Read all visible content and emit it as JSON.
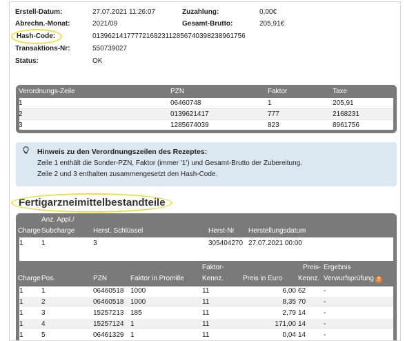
{
  "details": {
    "erstell_label": "Erstell-Datum:",
    "erstell_value": "27.07.2021 11:26:07",
    "zuzahlung_label": "Zuzahlung:",
    "zuzahlung_value": "0,00€",
    "abrechn_label": "Abrechn.-Monat:",
    "abrechn_value": "2021/09",
    "brutto_label": "Gesamt-Brutto:",
    "brutto_value": "205,91€",
    "hash_label": "Hash-Code:",
    "hash_value": "01396214177772168231128567403982389617 56",
    "hash_value_exact": "013962141777721682311285674039823896175 6",
    "trans_label": "Transaktions-Nr:",
    "trans_value": "550739027",
    "status_label": "Status:",
    "status_value": "OK"
  },
  "verordnung": {
    "headers": [
      "Verordnungs-Zeile",
      "PZN",
      "Faktor",
      "Taxe"
    ],
    "rows": [
      [
        "1",
        "06460748",
        "1",
        "205,91"
      ],
      [
        "2",
        "0139621417",
        "777",
        "2168231"
      ],
      [
        "3",
        "1285674039",
        "823",
        "8961756"
      ]
    ]
  },
  "hinweis": {
    "icon": "lightbulb-icon",
    "title": "Hinweis zu den Verordnungszeilen des Rezeptes:",
    "line1": "Zeile 1 enthält die Sonder-PZN, Faktor (immer '1') und Gesamt-Brutto der Zubereitung.",
    "line2": "Zeile 2 und 3 enthalten zusammengesetzt den Hash-Code."
  },
  "fertig": {
    "title": "Fertigarzneimittelbestandteile",
    "charge_table": {
      "h_anz1": "Anz. Appl./",
      "h_charge": "Charge",
      "h_subcharge": "Subcharge",
      "h_herst": "Herst. Schlüssel",
      "h_herstnr": "Herst-Nr",
      "h_datum": "Herstellungsdatum",
      "row": [
        "1",
        "1",
        "3",
        "305404270",
        "27.07.2021 00:00"
      ]
    },
    "pos_table": {
      "h_charge": "Charge",
      "h_pos": "Pos.",
      "h_pzn": "PZN",
      "h_faktor": "Faktor in Promille",
      "h_kennz1": "Faktor-",
      "h_kennz2": "Kennz.",
      "h_preis": "Preis in Euro",
      "h_pk1": "Preis-",
      "h_pk2": "Kennz.",
      "h_erg1": "Ergebnis",
      "h_erg2": "Verwurfsprüfung",
      "help_icon": "question-icon",
      "rows": [
        [
          "1",
          "1",
          "06460518",
          "1000",
          "11",
          "6,00",
          "62",
          "-"
        ],
        [
          "1",
          "2",
          "06460518",
          "1000",
          "11",
          "8,35",
          "70",
          "-"
        ],
        [
          "1",
          "3",
          "15257213",
          "185",
          "11",
          "2,79",
          "14",
          "-"
        ],
        [
          "1",
          "4",
          "15257124",
          "1",
          "11",
          "171,00",
          "14",
          "-"
        ],
        [
          "1",
          "5",
          "06461329",
          "1",
          "11",
          "0,04",
          "14",
          "-"
        ]
      ]
    }
  },
  "colors": {
    "header_grey": "#7a7a7a",
    "info_bg": "#dbe8f2",
    "highlight": "#f2dd3c",
    "help_orange": "#e8812a"
  }
}
